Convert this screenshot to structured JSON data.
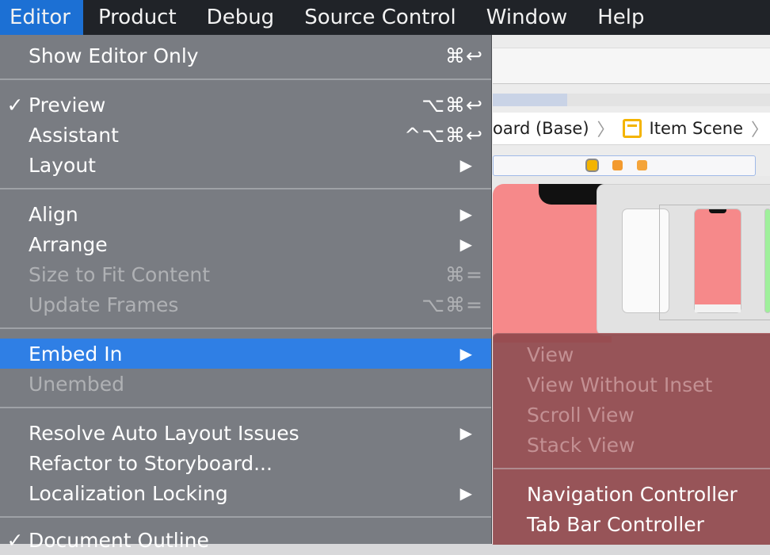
{
  "menubar": {
    "items": [
      {
        "label": "Editor"
      },
      {
        "label": "Product"
      },
      {
        "label": "Debug"
      },
      {
        "label": "Source Control"
      },
      {
        "label": "Window"
      },
      {
        "label": "Help"
      }
    ]
  },
  "editor_menu": {
    "show_editor_only": {
      "label": "Show Editor Only",
      "shortcut": "⌘↩"
    },
    "preview": {
      "label": "Preview",
      "check": "✓",
      "shortcut": "⌥⌘↩"
    },
    "assistant": {
      "label": "Assistant",
      "shortcut": "^⌥⌘↩"
    },
    "layout": {
      "label": "Layout",
      "arrow": "▶"
    },
    "align": {
      "label": "Align",
      "arrow": "▶"
    },
    "arrange": {
      "label": "Arrange",
      "arrow": "▶"
    },
    "size_to_fit": {
      "label": "Size to Fit Content",
      "shortcut": "⌘="
    },
    "update_frames": {
      "label": "Update Frames",
      "shortcut": "⌥⌘="
    },
    "embed_in": {
      "label": "Embed In",
      "arrow": "▶"
    },
    "unembed": {
      "label": "Unembed"
    },
    "resolve_auto_layout": {
      "label": "Resolve Auto Layout Issues",
      "arrow": "▶"
    },
    "refactor_storyboard": {
      "label": "Refactor to Storyboard..."
    },
    "localization_locking": {
      "label": "Localization Locking",
      "arrow": "▶"
    },
    "document_outline": {
      "label": "Document Outline",
      "check": "✓"
    }
  },
  "embed_submenu": {
    "view": "View",
    "view_without_inset": "View Without Inset",
    "scroll_view": "Scroll View",
    "stack_view": "Stack View",
    "navigation_controller": "Navigation Controller",
    "tab_bar_controller": "Tab Bar Controller"
  },
  "jumpbar": {
    "storyboard": "oard (Base)",
    "scene": "Item Scene"
  },
  "colors": {
    "menubar_bg": "#202328",
    "menubar_active": "#1c70d4",
    "menu_highlight": "#2f7fe5",
    "scene_icon": "#f4b400",
    "preview_red": "#f6898a"
  }
}
